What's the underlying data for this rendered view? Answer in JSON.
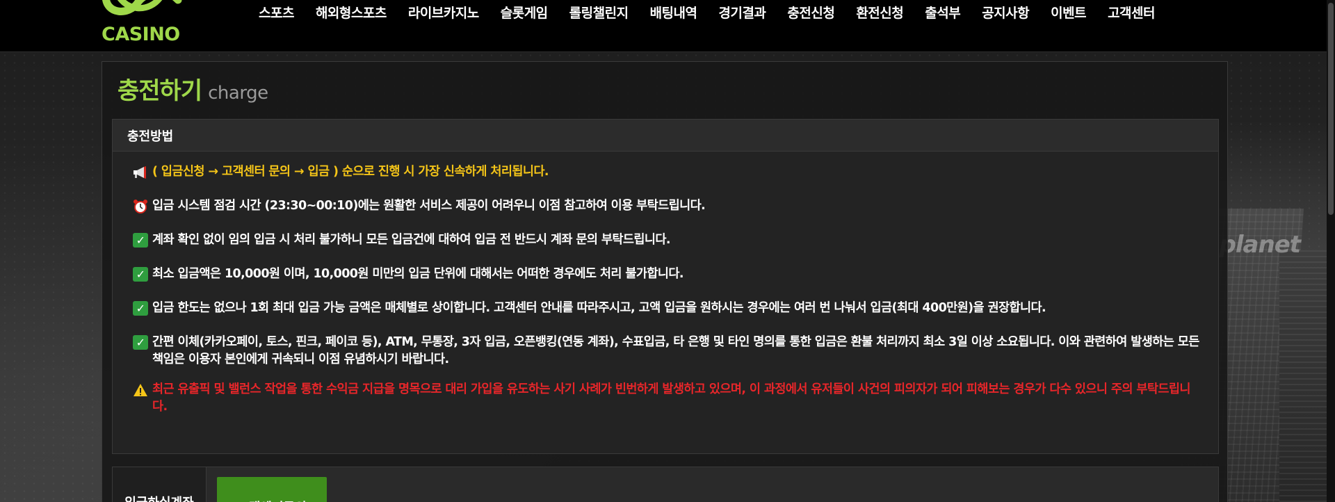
{
  "brand": {
    "logo_text": "CASINO",
    "accent_color": "#9fd84a"
  },
  "nav": {
    "items": [
      {
        "label": "스포츠"
      },
      {
        "label": "해외형스포츠"
      },
      {
        "label": "라이브카지노"
      },
      {
        "label": "슬롯게임"
      },
      {
        "label": "롤링챌린지"
      },
      {
        "label": "배팅내역"
      },
      {
        "label": "경기결과"
      },
      {
        "label": "충전신청"
      },
      {
        "label": "환전신청"
      },
      {
        "label": "출석부"
      },
      {
        "label": "공지사항"
      },
      {
        "label": "이벤트"
      },
      {
        "label": "고객센터"
      }
    ]
  },
  "page": {
    "title": "충전하기",
    "subtitle": "charge"
  },
  "method": {
    "title": "충전방법",
    "notices": [
      {
        "icon": "megaphone-icon",
        "color": "#f5c518",
        "text": "( 입금신청 → 고객센터 문의 → 입금 ) 순으로 진행 시 가장 신속하게 처리됩니다."
      },
      {
        "icon": "alarm-clock-icon",
        "color": "#ffffff",
        "text": "입금 시스템 점검 시간 (23:30~00:10)에는 원활한 서비스 제공이 어려우니 이점 참고하여 이용 부탁드립니다."
      },
      {
        "icon": "check-icon",
        "color": "#ffffff",
        "text": "계좌 확인 없이 임의 입금 시 처리 불가하니 모든 입금건에 대하여 입금 전 반드시 계좌 문의 부탁드립니다."
      },
      {
        "icon": "check-icon",
        "color": "#ffffff",
        "text": "최소 입금액은 10,000원 이며, 10,000원 미만의 입금 단위에 대해서는 어떠한 경우에도 처리 불가합니다."
      },
      {
        "icon": "check-icon",
        "color": "#ffffff",
        "text": "입금 한도는 없으나 1회 최대 입금 가능 금액은 매체별로 상이합니다. 고객센터 안내를 따라주시고, 고액 입금을 원하시는 경우에는 여러 번 나눠서 입금(최대 400만원)을 권장합니다."
      },
      {
        "icon": "check-icon",
        "color": "#ffffff",
        "text": "간편 이체(카카오페이, 토스, 핀크, 페이코 등), ATM, 무통장, 3자 입금, 오픈뱅킹(연동 계좌), 수표입금, 타 은행 및 타인 명의를 통한 입금은 환불 처리까지 최소 3일 이상 소요됩니다. 이와 관련하여 발생하는 모든 책임은 이용자 본인에게 귀속되니 이점 유념하시기 바랍니다."
      },
      {
        "icon": "warning-icon",
        "color": "#e8262a",
        "text": "최근 유출픽 및 밸런스 작업을 통한 수익금 지급을 명목으로 대리 가입을 유도하는 사기 사례가 빈번하게 발생하고 있으며, 이 과정에서 유저들이 사건의 피의자가 되어 피해보는 경우가 다수 있으니 주의 부탁드립니다."
      }
    ]
  },
  "tabs": {
    "deposit_account": "입금하실계좌",
    "support": "고객센터문의"
  },
  "background": {
    "sign_text": "planet"
  }
}
